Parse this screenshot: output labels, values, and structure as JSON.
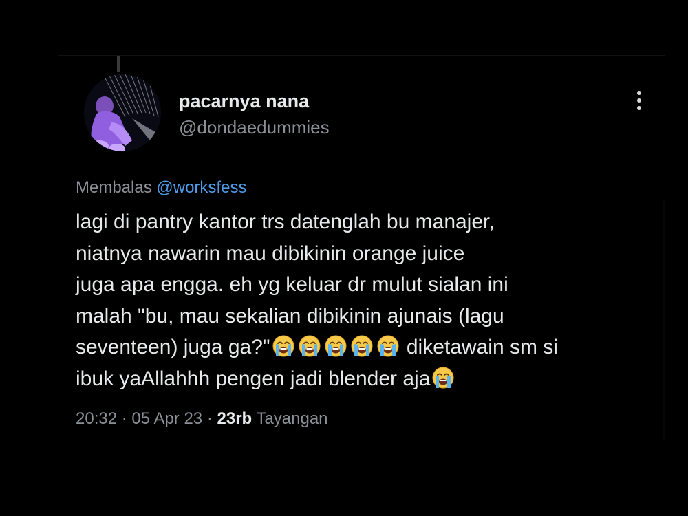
{
  "tweet": {
    "author": {
      "display_name": "pacarnya nana",
      "handle": "@dondaedummies",
      "avatar_icon": "profile-photo"
    },
    "menu_icon": "more-vertical-icon",
    "reply": {
      "prefix": "Membalas",
      "mention": "@worksfess"
    },
    "text_lines": [
      "lagi di pantry kantor trs datenglah bu manajer,",
      "niatnya nawarin mau dibikinin orange juice",
      "juga apa engga. eh yg keluar dr mulut sialan ini",
      "malah \"bu, mau sekalian dibikinin ajunais (lagu",
      "seventeen) juga ga?\"",
      "diketawain sm si",
      "ibuk yaAllahhh pengen jadi blender aja"
    ],
    "emoji_name": "loudly-crying-face",
    "meta": {
      "time": "20:32",
      "sep1": "·",
      "date": "05 Apr 23",
      "sep2": "·",
      "views_count": "23rb",
      "views_label": "Tayangan"
    }
  },
  "colors": {
    "background": "#000000",
    "text_primary": "#e7e9ea",
    "text_secondary": "#8b9096",
    "mention": "#4d9be9",
    "emoji_face": "#f7c948",
    "emoji_tears": "#5ab4f0"
  }
}
